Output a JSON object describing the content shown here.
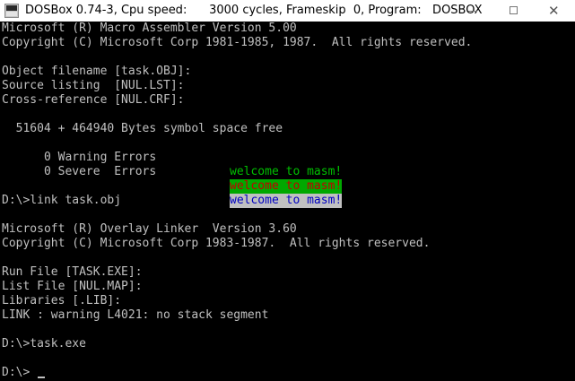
{
  "window": {
    "title": "DOSBox 0.74-3, Cpu speed:      3000 cycles, Frameskip  0, Program:   DOSBOX",
    "icon": "dosbox-app-icon",
    "minimize_icon": "minimize-icon",
    "maximize_icon": "maximize-icon",
    "close_glyph": "✕"
  },
  "console": {
    "lines": [
      "Microsoft (R) Macro Assembler Version 5.00",
      "Copyright (C) Microsoft Corp 1981-1985, 1987.  All rights reserved.",
      "",
      "Object filename [task.OBJ]:",
      "Source listing  [NUL.LST]:",
      "Cross-reference [NUL.CRF]:",
      "",
      "  51604 + 464940 Bytes symbol space free",
      "",
      "      0 Warning Errors",
      "      0 Severe  Errors",
      "",
      "D:\\>link task.obj",
      "",
      "Microsoft (R) Overlay Linker  Version 3.60",
      "Copyright (C) Microsoft Corp 1983-1987.  All rights reserved.",
      "",
      "Run File [TASK.EXE]:",
      "List File [NUL.MAP]:",
      "Libraries [.LIB]:",
      "LINK : warning L4021: no stack segment",
      "",
      "D:\\>task.exe",
      "",
      "D:\\> "
    ],
    "welcome_messages": [
      {
        "text": "welcome to masm!",
        "fg": "#00c000",
        "bg": "#000000"
      },
      {
        "text": "welcome to masm!",
        "fg": "#c00000",
        "bg": "#00a800"
      },
      {
        "text": "welcome to masm!",
        "fg": "#0000c0",
        "bg": "#c0c0c0"
      }
    ]
  },
  "colors": {
    "console_text": "#c0c0c0",
    "console_background": "#000000",
    "titlebar_background": "#ffffff"
  }
}
